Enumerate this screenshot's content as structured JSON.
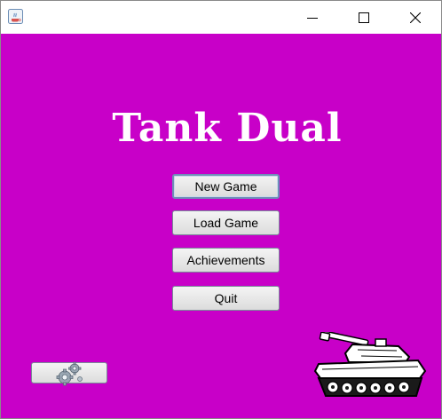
{
  "window": {
    "title": ""
  },
  "game": {
    "title": "Tank Dual"
  },
  "menu": {
    "new_game": "New Game",
    "load_game": "Load Game",
    "achievements": "Achievements",
    "quit": "Quit"
  },
  "icons": {
    "app": "java-app-icon",
    "settings": "gears-icon",
    "decoration": "tank-image"
  },
  "colors": {
    "background": "#c800c8",
    "title_text": "#ffffff",
    "button_face": "#e6e6e6",
    "focus_border": "#6f8fb8"
  }
}
